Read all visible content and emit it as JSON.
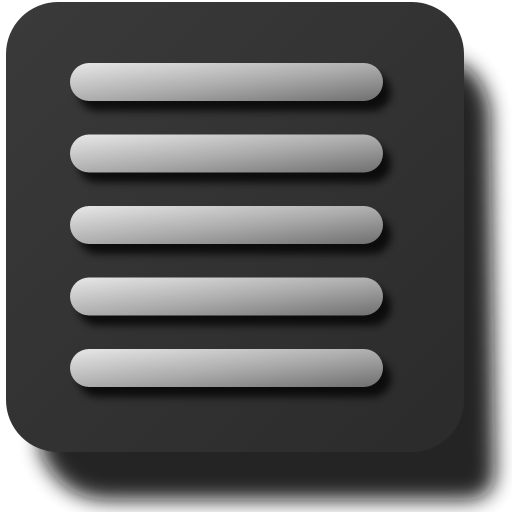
{
  "icon": {
    "name": "menu-list-icon",
    "line_count": 5
  },
  "colors": {
    "tile": "#2b2b2b",
    "tile_highlight": "#3a3a3a",
    "shadow": "#0a0a0a",
    "bar_light": "#e8e8e8",
    "bar_mid": "#a9a9a9",
    "bar_dark": "#6f6f6f"
  }
}
